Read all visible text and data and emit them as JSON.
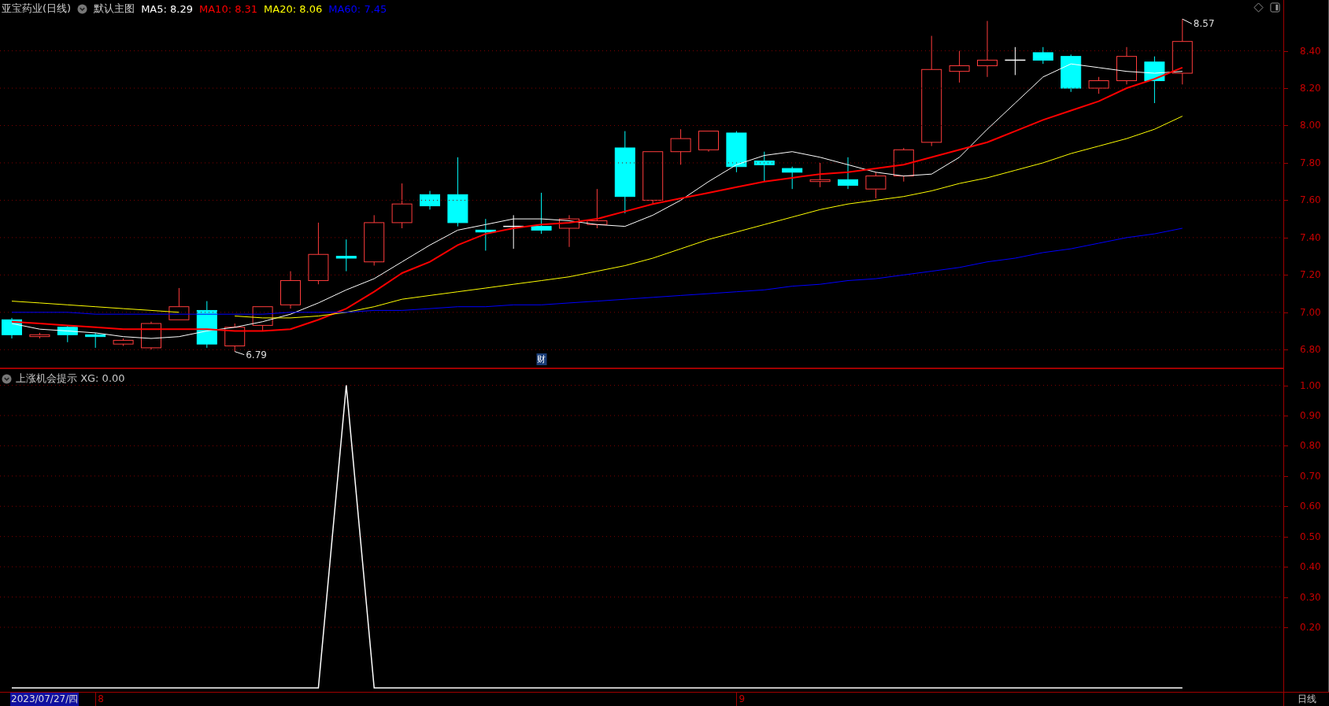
{
  "header": {
    "title": "亚宝药业(日线)",
    "template": "默认主图",
    "legend": [
      {
        "label": "MA5: 8.29",
        "color": "#ffffff"
      },
      {
        "label": "MA10: 8.31",
        "color": "#ff0000"
      },
      {
        "label": "MA20: 8.06",
        "color": "#ffff00"
      },
      {
        "label": "MA60: 7.45",
        "color": "#0000ff"
      }
    ]
  },
  "main_chart": {
    "chart_data": {
      "type": "line",
      "ylim": [
        6.7,
        8.672
      ],
      "yticks": [
        {
          "value": 6.8,
          "label": "6.80"
        },
        {
          "value": 7.0,
          "label": "7.00"
        },
        {
          "value": 7.2,
          "label": "7.20"
        },
        {
          "value": 7.4,
          "label": "7.40"
        },
        {
          "value": 7.6,
          "label": "7.60"
        },
        {
          "value": 7.8,
          "label": "7.80"
        },
        {
          "value": 8.0,
          "label": "8.00"
        },
        {
          "value": 8.2,
          "label": "8.20"
        },
        {
          "value": 8.4,
          "label": "8.40"
        }
      ],
      "series": [
        {
          "color": "#ffffff",
          "values": [
            6.94,
            6.91,
            6.9,
            6.89,
            6.87,
            6.86,
            6.87,
            6.9,
            6.92,
            6.95,
            6.99,
            7.05,
            7.12,
            7.18,
            7.27,
            7.36,
            7.44,
            7.47,
            7.5,
            7.5,
            7.49,
            7.47,
            7.46,
            7.52,
            7.6,
            7.7,
            7.79,
            7.84,
            7.86,
            7.83,
            7.79,
            7.75,
            7.73,
            7.74,
            7.83,
            7.98,
            8.12,
            8.26,
            8.33,
            8.31,
            8.29,
            8.28,
            8.29
          ]
        },
        {
          "color": "#ff0000",
          "values": [
            6.95,
            6.94,
            6.93,
            6.92,
            6.91,
            6.91,
            6.91,
            6.91,
            6.9,
            6.9,
            6.91,
            6.96,
            7.02,
            7.11,
            7.21,
            7.27,
            7.36,
            7.42,
            7.45,
            7.47,
            7.48,
            7.5,
            7.54,
            7.58,
            7.61,
            7.64,
            7.67,
            7.7,
            7.72,
            7.74,
            7.75,
            7.77,
            7.79,
            7.83,
            7.87,
            7.91,
            7.97,
            8.03,
            8.08,
            8.13,
            8.2,
            8.25,
            8.31
          ]
        },
        {
          "color": "#ffff00",
          "values": [
            7.06,
            7.05,
            7.04,
            7.03,
            7.02,
            7.01,
            7.0,
            null,
            6.98,
            6.97,
            6.97,
            6.98,
            7.0,
            7.03,
            7.07,
            7.09,
            7.11,
            7.13,
            7.15,
            7.17,
            7.19,
            7.22,
            7.25,
            7.29,
            7.34,
            7.39,
            7.43,
            7.47,
            7.51,
            7.55,
            7.58,
            7.6,
            7.62,
            7.65,
            7.69,
            7.72,
            7.76,
            7.8,
            7.85,
            7.89,
            7.93,
            7.98,
            8.05
          ]
        },
        {
          "color": "#0000ff",
          "values": [
            7.0,
            7.0,
            7.0,
            6.99,
            6.99,
            6.99,
            6.99,
            6.99,
            6.99,
            6.99,
            7.0,
            7.0,
            7.0,
            7.01,
            7.01,
            7.02,
            7.03,
            7.03,
            7.04,
            7.04,
            7.05,
            7.06,
            7.07,
            7.08,
            7.09,
            7.1,
            7.11,
            7.12,
            7.14,
            7.15,
            7.17,
            7.18,
            7.2,
            7.22,
            7.24,
            7.27,
            7.29,
            7.32,
            7.34,
            7.37,
            7.4,
            7.42,
            7.45
          ]
        }
      ],
      "grid": true,
      "annotations": [
        "8.57",
        "6.79",
        "财"
      ]
    }
  },
  "indicator": {
    "title": "上涨机会提示 XG: 0.00",
    "chart_data": {
      "type": "line",
      "ylim": [
        -0.016,
        1.056
      ],
      "grid": true,
      "yticks": [
        {
          "value": 0.2,
          "label": "0.20"
        },
        {
          "value": 0.3,
          "label": "0.30"
        },
        {
          "value": 0.4,
          "label": "0.40"
        },
        {
          "value": 0.5,
          "label": "0.50"
        },
        {
          "value": 0.6,
          "label": "0.60"
        },
        {
          "value": 0.7,
          "label": "0.70"
        },
        {
          "value": 0.8,
          "label": "0.80"
        },
        {
          "value": 0.9,
          "label": "0.90"
        },
        {
          "value": 1.0,
          "label": "1.00"
        }
      ],
      "series": [
        {
          "color": "#ffffff",
          "values": [
            0,
            0,
            0,
            0,
            0,
            0,
            0,
            0,
            0,
            0,
            0,
            0,
            1,
            0,
            0,
            0,
            0,
            0,
            0,
            0,
            0,
            0,
            0,
            0,
            0,
            0,
            0,
            0,
            0,
            0,
            0,
            0,
            0,
            0,
            0,
            0,
            0,
            0,
            0,
            0,
            0,
            0,
            0
          ]
        }
      ]
    }
  },
  "time_axis": {
    "cursor_date": "2023/07/27/四",
    "month_labels": [
      "8",
      "9"
    ],
    "period": "日线"
  }
}
